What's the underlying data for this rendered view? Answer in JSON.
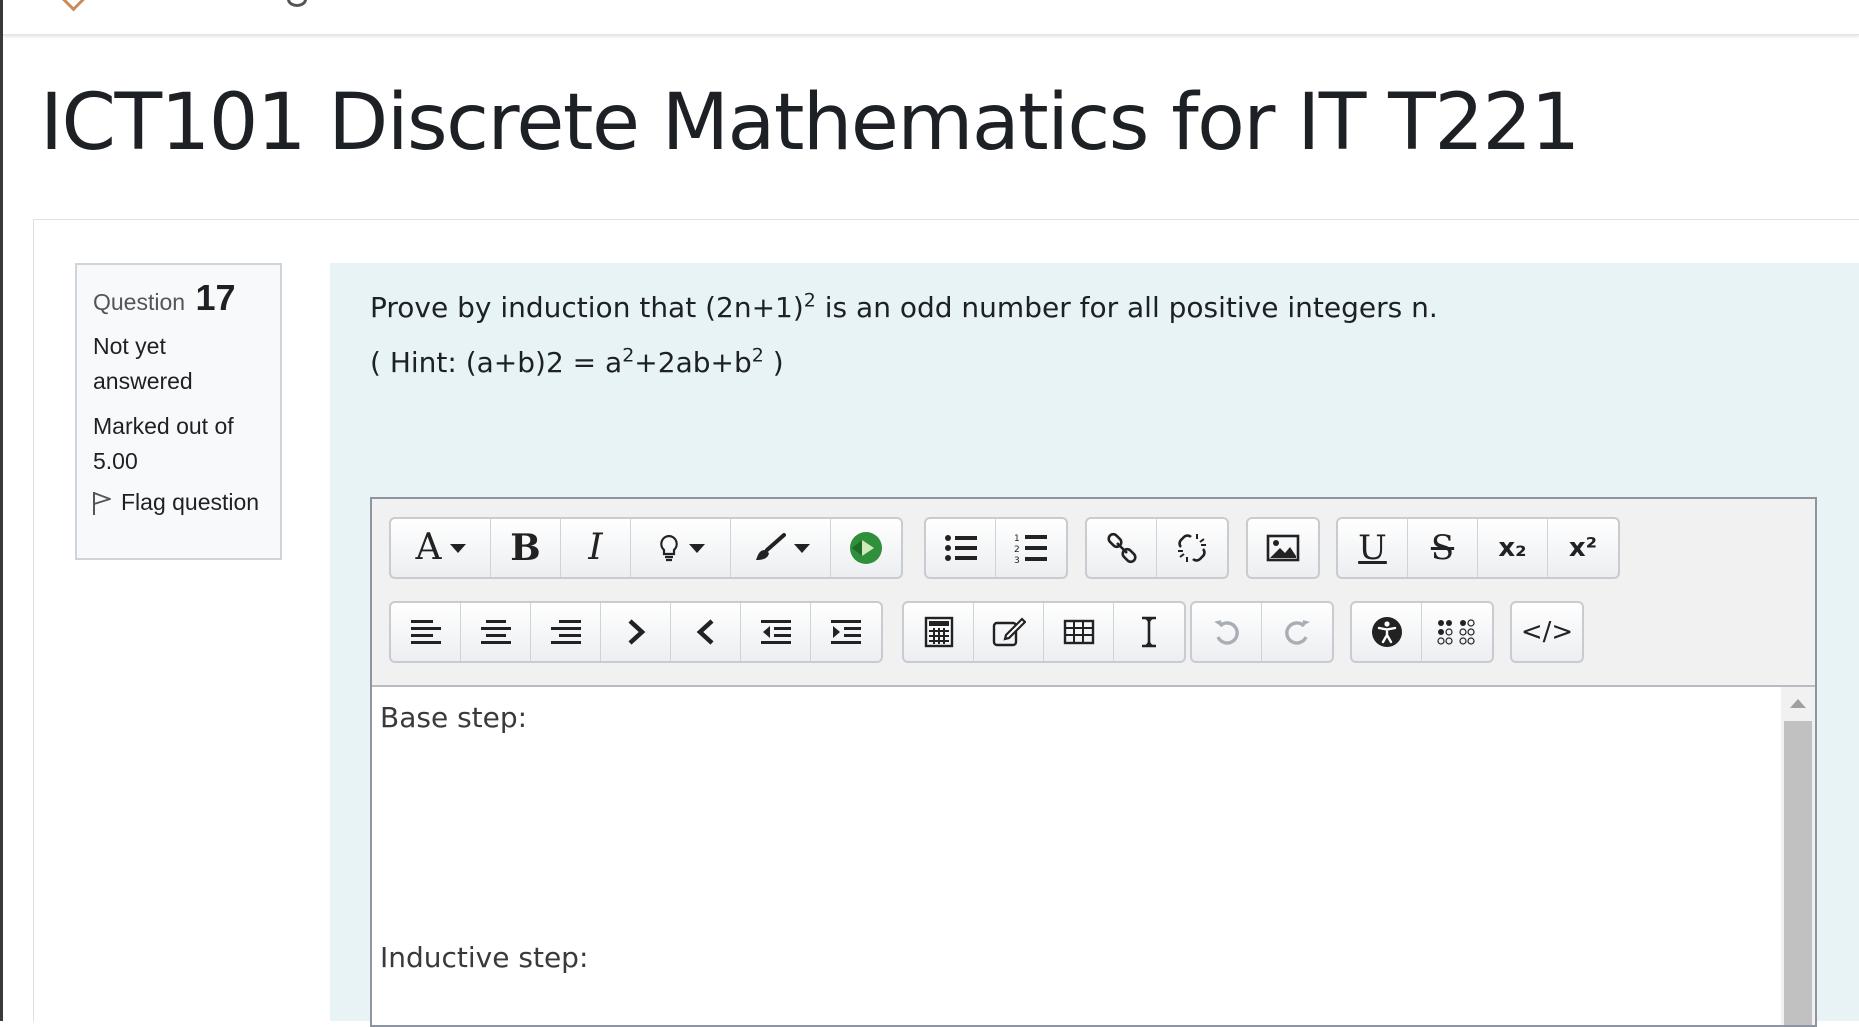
{
  "course": {
    "title": "ICT101 Discrete Mathematics for IT T221"
  },
  "question_info": {
    "label": "Question",
    "number": "17",
    "state": "Not yet answered",
    "grade": "Marked out of 5.00",
    "flag_label": "Flag question"
  },
  "question": {
    "line1_pre": "Prove by induction that (2n+1)",
    "line1_sup": "2",
    "line1_post": " is an odd number for all positive integers n.",
    "hint_pre": "( Hint: (a+b)2 = a",
    "hint_sup1": "2",
    "hint_mid": "+2ab+b",
    "hint_sup2": "2",
    "hint_post": " )"
  },
  "editor": {
    "toolbar": {
      "font_letter": "A",
      "bold": "B",
      "italic": "I",
      "underline": "U",
      "strike": "S",
      "subscript": "x₂",
      "superscript": "x²",
      "html": "</>"
    },
    "content": {
      "base_step": "Base step:",
      "inductive_step": "Inductive step:"
    }
  },
  "colors": {
    "content_bg": "#e7f3f5",
    "info_bg": "#f8f9fa",
    "text": "#1d2125",
    "accent": "#c98b5a"
  }
}
